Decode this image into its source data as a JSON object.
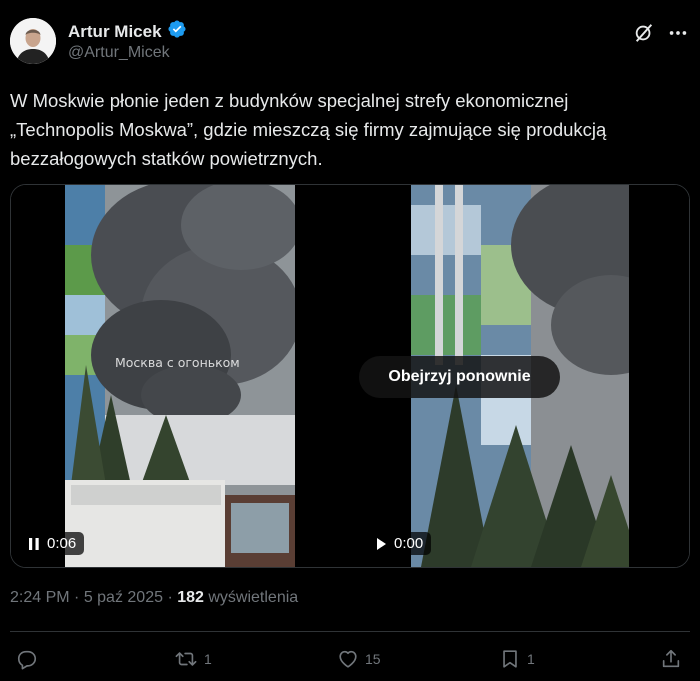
{
  "author": {
    "name": "Artur Micek",
    "handle": "@Artur_Micek",
    "verified": true,
    "verified_color": "#1d9bf0"
  },
  "tweet": {
    "text_lines": [
      "W Moskwie płonie jeden z budynków specjalnej strefy ekonomicznej",
      "„Technopolis Moskwa”, gdzie mieszczą się firmy zajmujące się produkcją",
      "bezzałogowych statków powietrznych."
    ]
  },
  "media": {
    "video1": {
      "watermark": "Москва с огоньком",
      "time": "0:06",
      "state_icon": "pause-icon"
    },
    "video2": {
      "replay_label": "Obejrzyj ponownie",
      "time": "0:00",
      "state_icon": "play-icon"
    }
  },
  "meta": {
    "time": "2:24 PM",
    "sep": " · ",
    "date": "5 paź 2025",
    "views_count": "182",
    "views_label": " wyświetlenia"
  },
  "actions": {
    "reply_count": "",
    "retweet_count": "1",
    "like_count": "15",
    "bookmark_count": "1"
  },
  "icons": [
    "grok-icon",
    "more-icon",
    "reply-icon",
    "retweet-icon",
    "like-icon",
    "bookmark-icon",
    "share-icon"
  ],
  "colors": {
    "background": "#000000",
    "text": "#e7e9ea",
    "secondary": "#71767b",
    "border": "#2f3336"
  }
}
